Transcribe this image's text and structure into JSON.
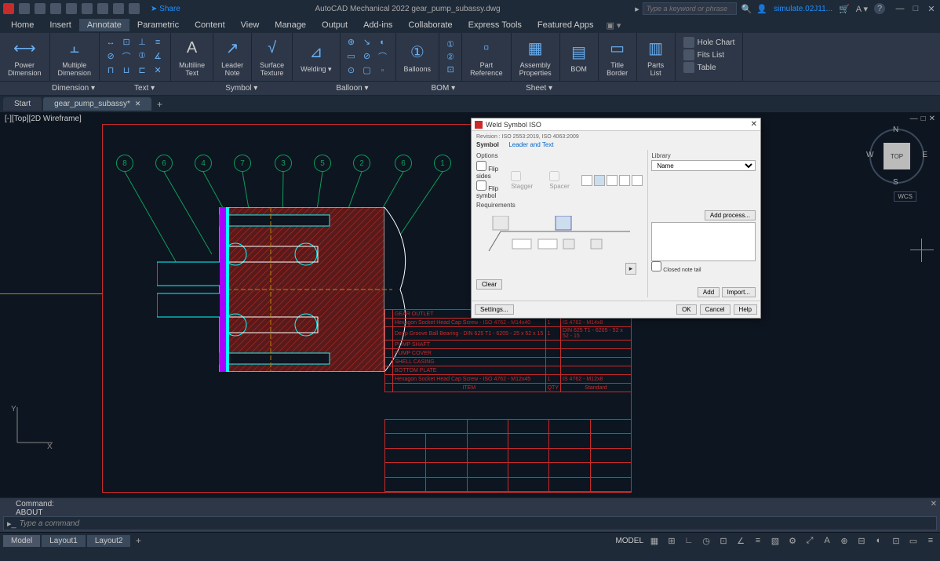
{
  "titlebar": {
    "share": "Share",
    "app_title": "AutoCAD Mechanical 2022    gear_pump_subassy.dwg",
    "search_placeholder": "Type a keyword or phrase",
    "user": "simulate.02J11...",
    "cart_icon": "cart",
    "help_icon": "?"
  },
  "menubar": [
    "Home",
    "Insert",
    "Annotate",
    "Parametric",
    "Content",
    "View",
    "Manage",
    "Output",
    "Add-ins",
    "Collaborate",
    "Express Tools",
    "Featured Apps"
  ],
  "menubar_active": "Annotate",
  "ribbon": {
    "power_dim": "Power\nDimension",
    "multi_dim": "Multiple\nDimension",
    "multiline_text": "Multiline\nText",
    "leader_note": "Leader\nNote",
    "surface_texture": "Surface\nTexture",
    "welding": "Welding",
    "balloons": "Balloons",
    "part_reference": "Part\nReference",
    "assembly_properties": "Assembly\nProperties",
    "bom": "BOM",
    "title_border": "Title\nBorder",
    "parts_list": "Parts\nList",
    "hole_chart": "Hole Chart",
    "fits_list": "Fits List",
    "table": "Table"
  },
  "panel_footer": {
    "dimension": "Dimension ▾",
    "text": "Text ▾",
    "symbol": "Symbol ▾",
    "balloon": "Balloon ▾",
    "bom": "BOM ▾",
    "sheet": "Sheet ▾"
  },
  "file_tabs": {
    "start": "Start",
    "active": "gear_pump_subassy*"
  },
  "view_label": "[-][Top][2D Wireframe]",
  "balloons": [
    "8",
    "6",
    "4",
    "7",
    "3",
    "5",
    "2",
    "6",
    "1"
  ],
  "bom_rows": [
    {
      "no": "",
      "desc": "GEAR OUTLET",
      "qty": "",
      "std": ""
    },
    {
      "no": "",
      "desc": "Hexagon Socket Head Cap Screw - ISO 4762 - M14x40",
      "qty": "1",
      "std": "IS 4762 - M14x8"
    },
    {
      "no": "",
      "desc": "Deep Groove Ball Bearing - DIN 625 T1 - 6205 - 25 x 52 x 15",
      "qty": "1",
      "std": "DIN 625 T1 - 6205 - 52 x 52 - 15"
    },
    {
      "no": "",
      "desc": "PUMP SHAFT",
      "qty": "",
      "std": ""
    },
    {
      "no": "",
      "desc": "PUMP COVER",
      "qty": "",
      "std": ""
    },
    {
      "no": "",
      "desc": "SHELL CASING",
      "qty": "",
      "std": ""
    },
    {
      "no": "",
      "desc": "BOTTOM PLATE",
      "qty": "",
      "std": ""
    },
    {
      "no": "",
      "desc": "Hexagon Socket Head Cap Screw - ISO 4762 - M12x45",
      "qty": "1",
      "std": "IS 4762 - M12x8"
    }
  ],
  "bom_footer": {
    "item": "ITEM",
    "qty": "QTY",
    "std": "Standard"
  },
  "dialog": {
    "title": "Weld Symbol ISO",
    "revision": "Revision : ISO 2553:2019, ISO 4063:2009",
    "symbol_label": "Symbol",
    "leader_text": "Leader and Text",
    "options": "Options",
    "flip_sides": "Flip sides",
    "flip_symbol": "Flip symbol",
    "stagger": "Stagger",
    "spacer": "Spacer",
    "requirements": "Requirements",
    "library": "Library",
    "name": "Name",
    "add_process": "Add process...",
    "closed_note_tail": "Closed note tail",
    "clear": "Clear",
    "add": "Add",
    "import": "Import...",
    "settings": "Settings...",
    "ok": "OK",
    "cancel": "Cancel",
    "help": "Help"
  },
  "viewcube": {
    "top": "TOP",
    "n": "N",
    "s": "S",
    "e": "E",
    "w": "W"
  },
  "wcs": "WCS",
  "ucs": {
    "x": "X",
    "y": "Y"
  },
  "cmdline": {
    "l1": "Command:",
    "l2": "ABOUT",
    "placeholder": "Type a command"
  },
  "statusbar": {
    "model": "Model",
    "layout1": "Layout1",
    "layout2": "Layout2",
    "model_label": "MODEL"
  }
}
